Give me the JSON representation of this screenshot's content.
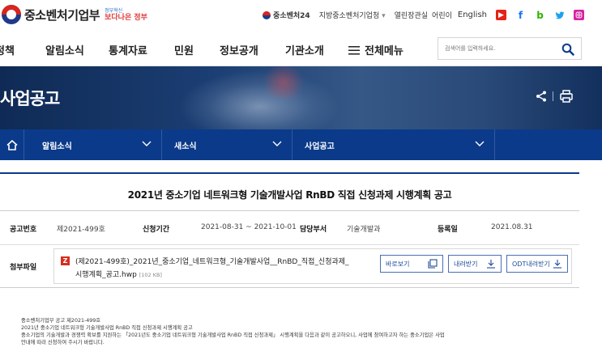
{
  "header": {
    "logo_text": "중소벤처기업부",
    "logo_sub_small": "정부혁신",
    "logo_sub_big": "보다나은 정부",
    "links": {
      "site24": "중소벤처24",
      "regional": "지방중소벤처기업청",
      "regional_arrow": "▾",
      "open_minister": "열린장관실",
      "kids": "어린이",
      "english": "English"
    }
  },
  "gnb": {
    "items": [
      "정책",
      "알림소식",
      "통계자료",
      "민원",
      "정보공개",
      "기관소개"
    ],
    "all_menu": "전체메뉴",
    "search_placeholder": "검색어를 입력하세요."
  },
  "banner": {
    "title": "사업공고"
  },
  "location": {
    "items": [
      "알림소식",
      "새소식",
      "사업공고"
    ]
  },
  "post": {
    "title": "2021년 중소기업 네트워크형 기술개발사업 RnBD 직접 신청과제 시행계획 공고",
    "labels": {
      "notice_no": "공고번호",
      "period": "신청기간",
      "department": "담당부서",
      "reg_date": "등록일",
      "attachment": "첨부파일"
    },
    "values": {
      "notice_no": "제2021-499호",
      "period": "2021-08-31 ~ 2021-10-01",
      "department": "기술개발과",
      "reg_date": "2021.08.31"
    },
    "attachment": {
      "name_line1": "(제2021-499호)_2021년_중소기업_네트워크형_기술개발사업__RnBD_직접_신청과제_",
      "name_line2": "시행계획_공고.hwp",
      "size": "[102 KB]",
      "buttons": {
        "view": "바로보기",
        "download": "내려받기",
        "odt": "ODT내려받기"
      }
    },
    "body_lines": [
      "중소벤처기업부 공고 제2021-499호",
      "2021년 중소기업 네트워크형 기술개발사업  RnBD 직접 신청과제 시행계획 공고",
      "중소기업의 기술개발과 경쟁력 확보를 지원하는 「2021년도 중소기업 네트워크형 기술개발사업  RnBD 직접 신청과제」 시행계획을 다음과 같이 공고하오니, 사업에 참여하고자 하는 중소기업은 사업",
      "안내에 따라 신청하여 주시기 바랍니다."
    ]
  },
  "colors": {
    "primary": "#0b3a8a",
    "banner": "#1b3e73",
    "file_icon": "#d62d20"
  }
}
